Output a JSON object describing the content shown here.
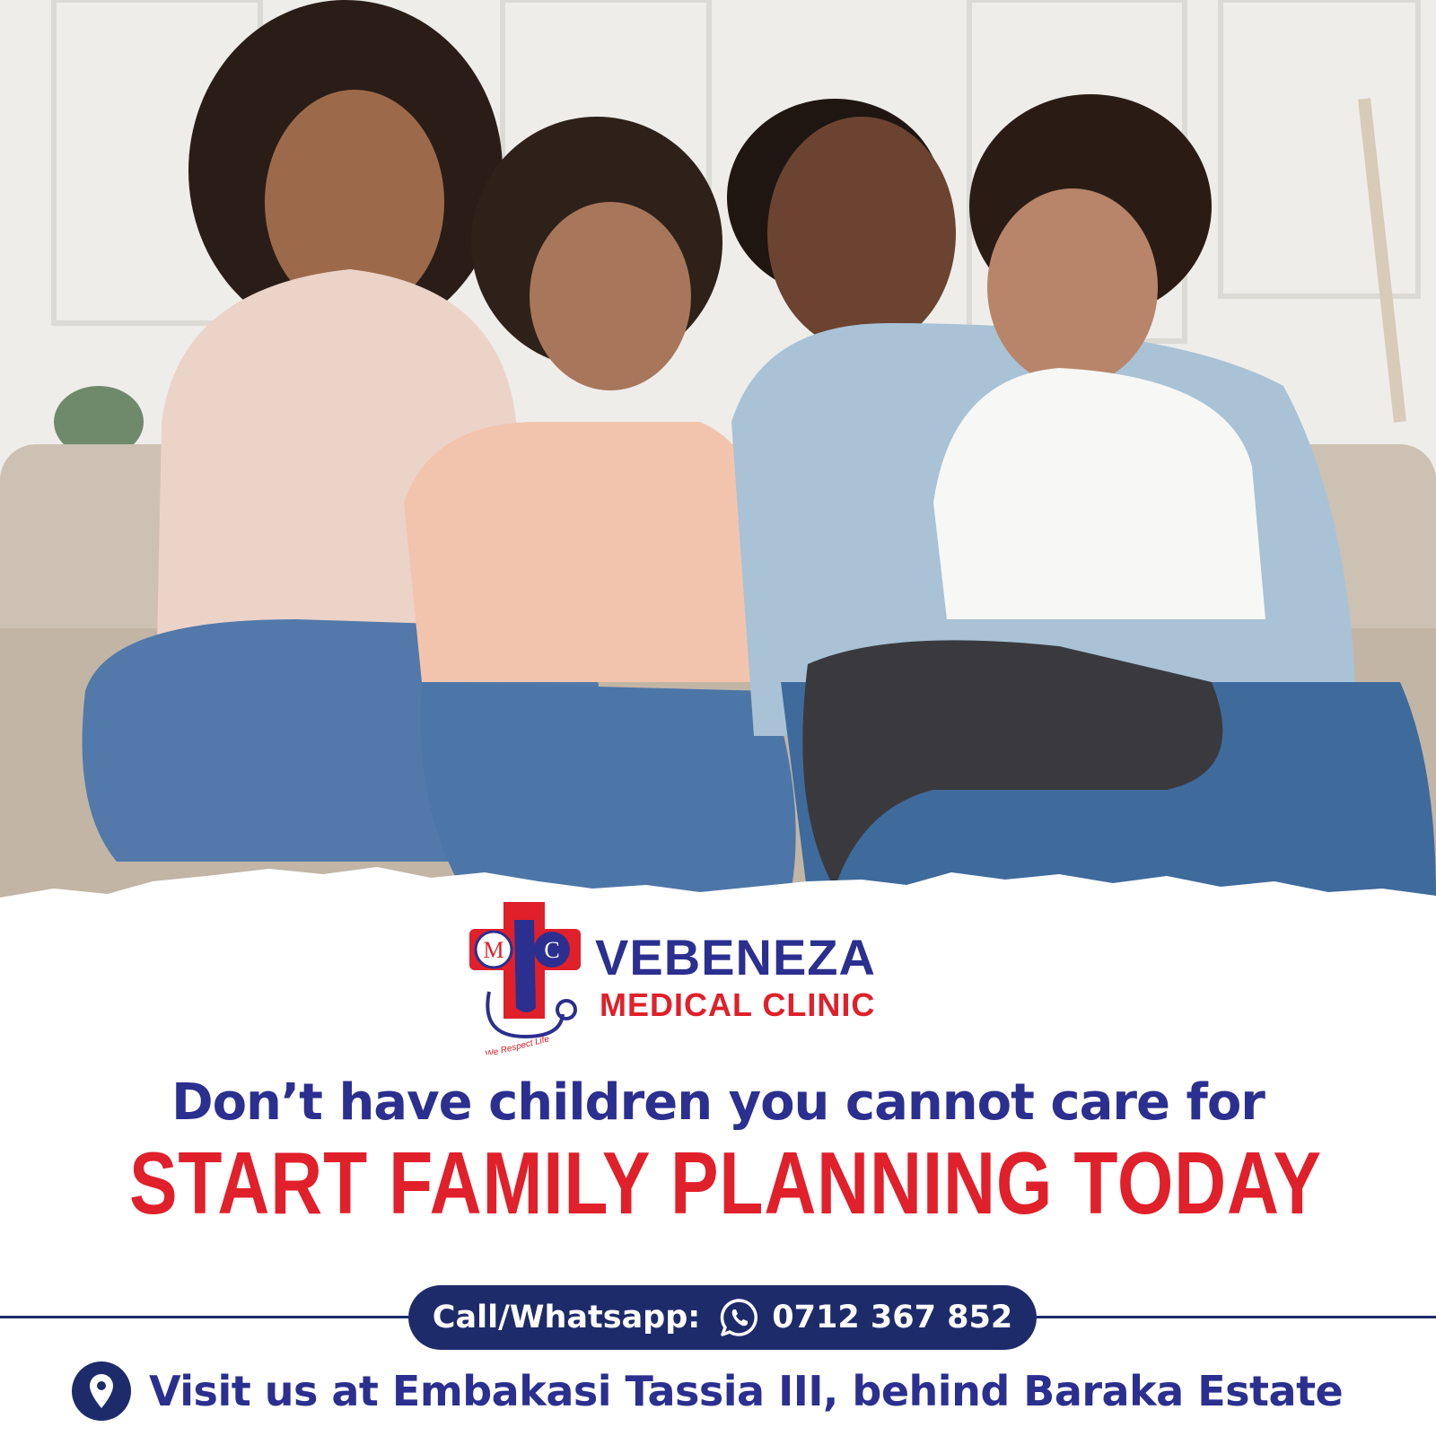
{
  "photo": {
    "description_icon": "family-photo",
    "colors": {
      "wall": "#ecebe8",
      "sofa": "#cbbfb1",
      "denim": "#4a78aa"
    }
  },
  "brand": {
    "logo_letters_left": "M",
    "logo_letters_right": "C",
    "logo_tagline": "We Respect Life",
    "name": "VEBENEZA",
    "subtitle": "MEDICAL CLINIC",
    "colors": {
      "blue": "#2b2f8f",
      "red": "#e0202a"
    }
  },
  "headline": {
    "line1": "Don’t have children you cannot care for",
    "line2": "START FAMILY PLANNING TODAY"
  },
  "contact": {
    "label": "Call/Whatsapp:",
    "icon": "whatsapp-icon",
    "phone": "0712 367 852",
    "pill_color": "#1e2b6b"
  },
  "address": {
    "icon": "location-pin-icon",
    "text": "Visit us at Embakasi Tassia III, behind Baraka Estate"
  }
}
